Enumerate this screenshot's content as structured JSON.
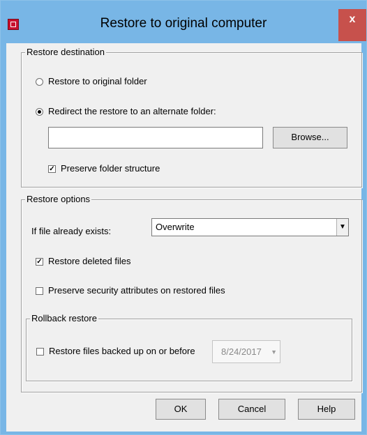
{
  "window": {
    "title": "Restore to original computer",
    "close_label": "x",
    "app_icon": "red-square-app-icon",
    "colors": {
      "frame": "#78b6e6",
      "close_button": "#c7514c",
      "client": "#f0f0f0"
    }
  },
  "destination": {
    "group_title": "Restore destination",
    "radio_original_label": "Restore to original folder",
    "radio_original_checked": false,
    "radio_redirect_label": "Redirect the restore to an alternate folder:",
    "radio_redirect_checked": true,
    "folder_input_value": "",
    "browse_label": "Browse...",
    "preserve_structure_label": "Preserve folder structure",
    "preserve_structure_checked": true,
    "check_mark": "✓"
  },
  "options": {
    "group_title": "Restore options",
    "if_exists_label": "If file already exists:",
    "if_exists_value": "Overwrite",
    "dropdown_arrow": "▼",
    "restore_deleted_label": "Restore deleted files",
    "restore_deleted_checked": true,
    "preserve_security_label": "Preserve security attributes on restored files",
    "preserve_security_checked": false,
    "rollback": {
      "group_title": "Rollback restore",
      "restore_before_label": "Restore files backed up on or before",
      "restore_before_checked": false,
      "date_value": "8/24/2017",
      "date_arrow": "▼"
    }
  },
  "buttons": {
    "ok_label": "OK",
    "cancel_label": "Cancel",
    "help_label": "Help"
  }
}
